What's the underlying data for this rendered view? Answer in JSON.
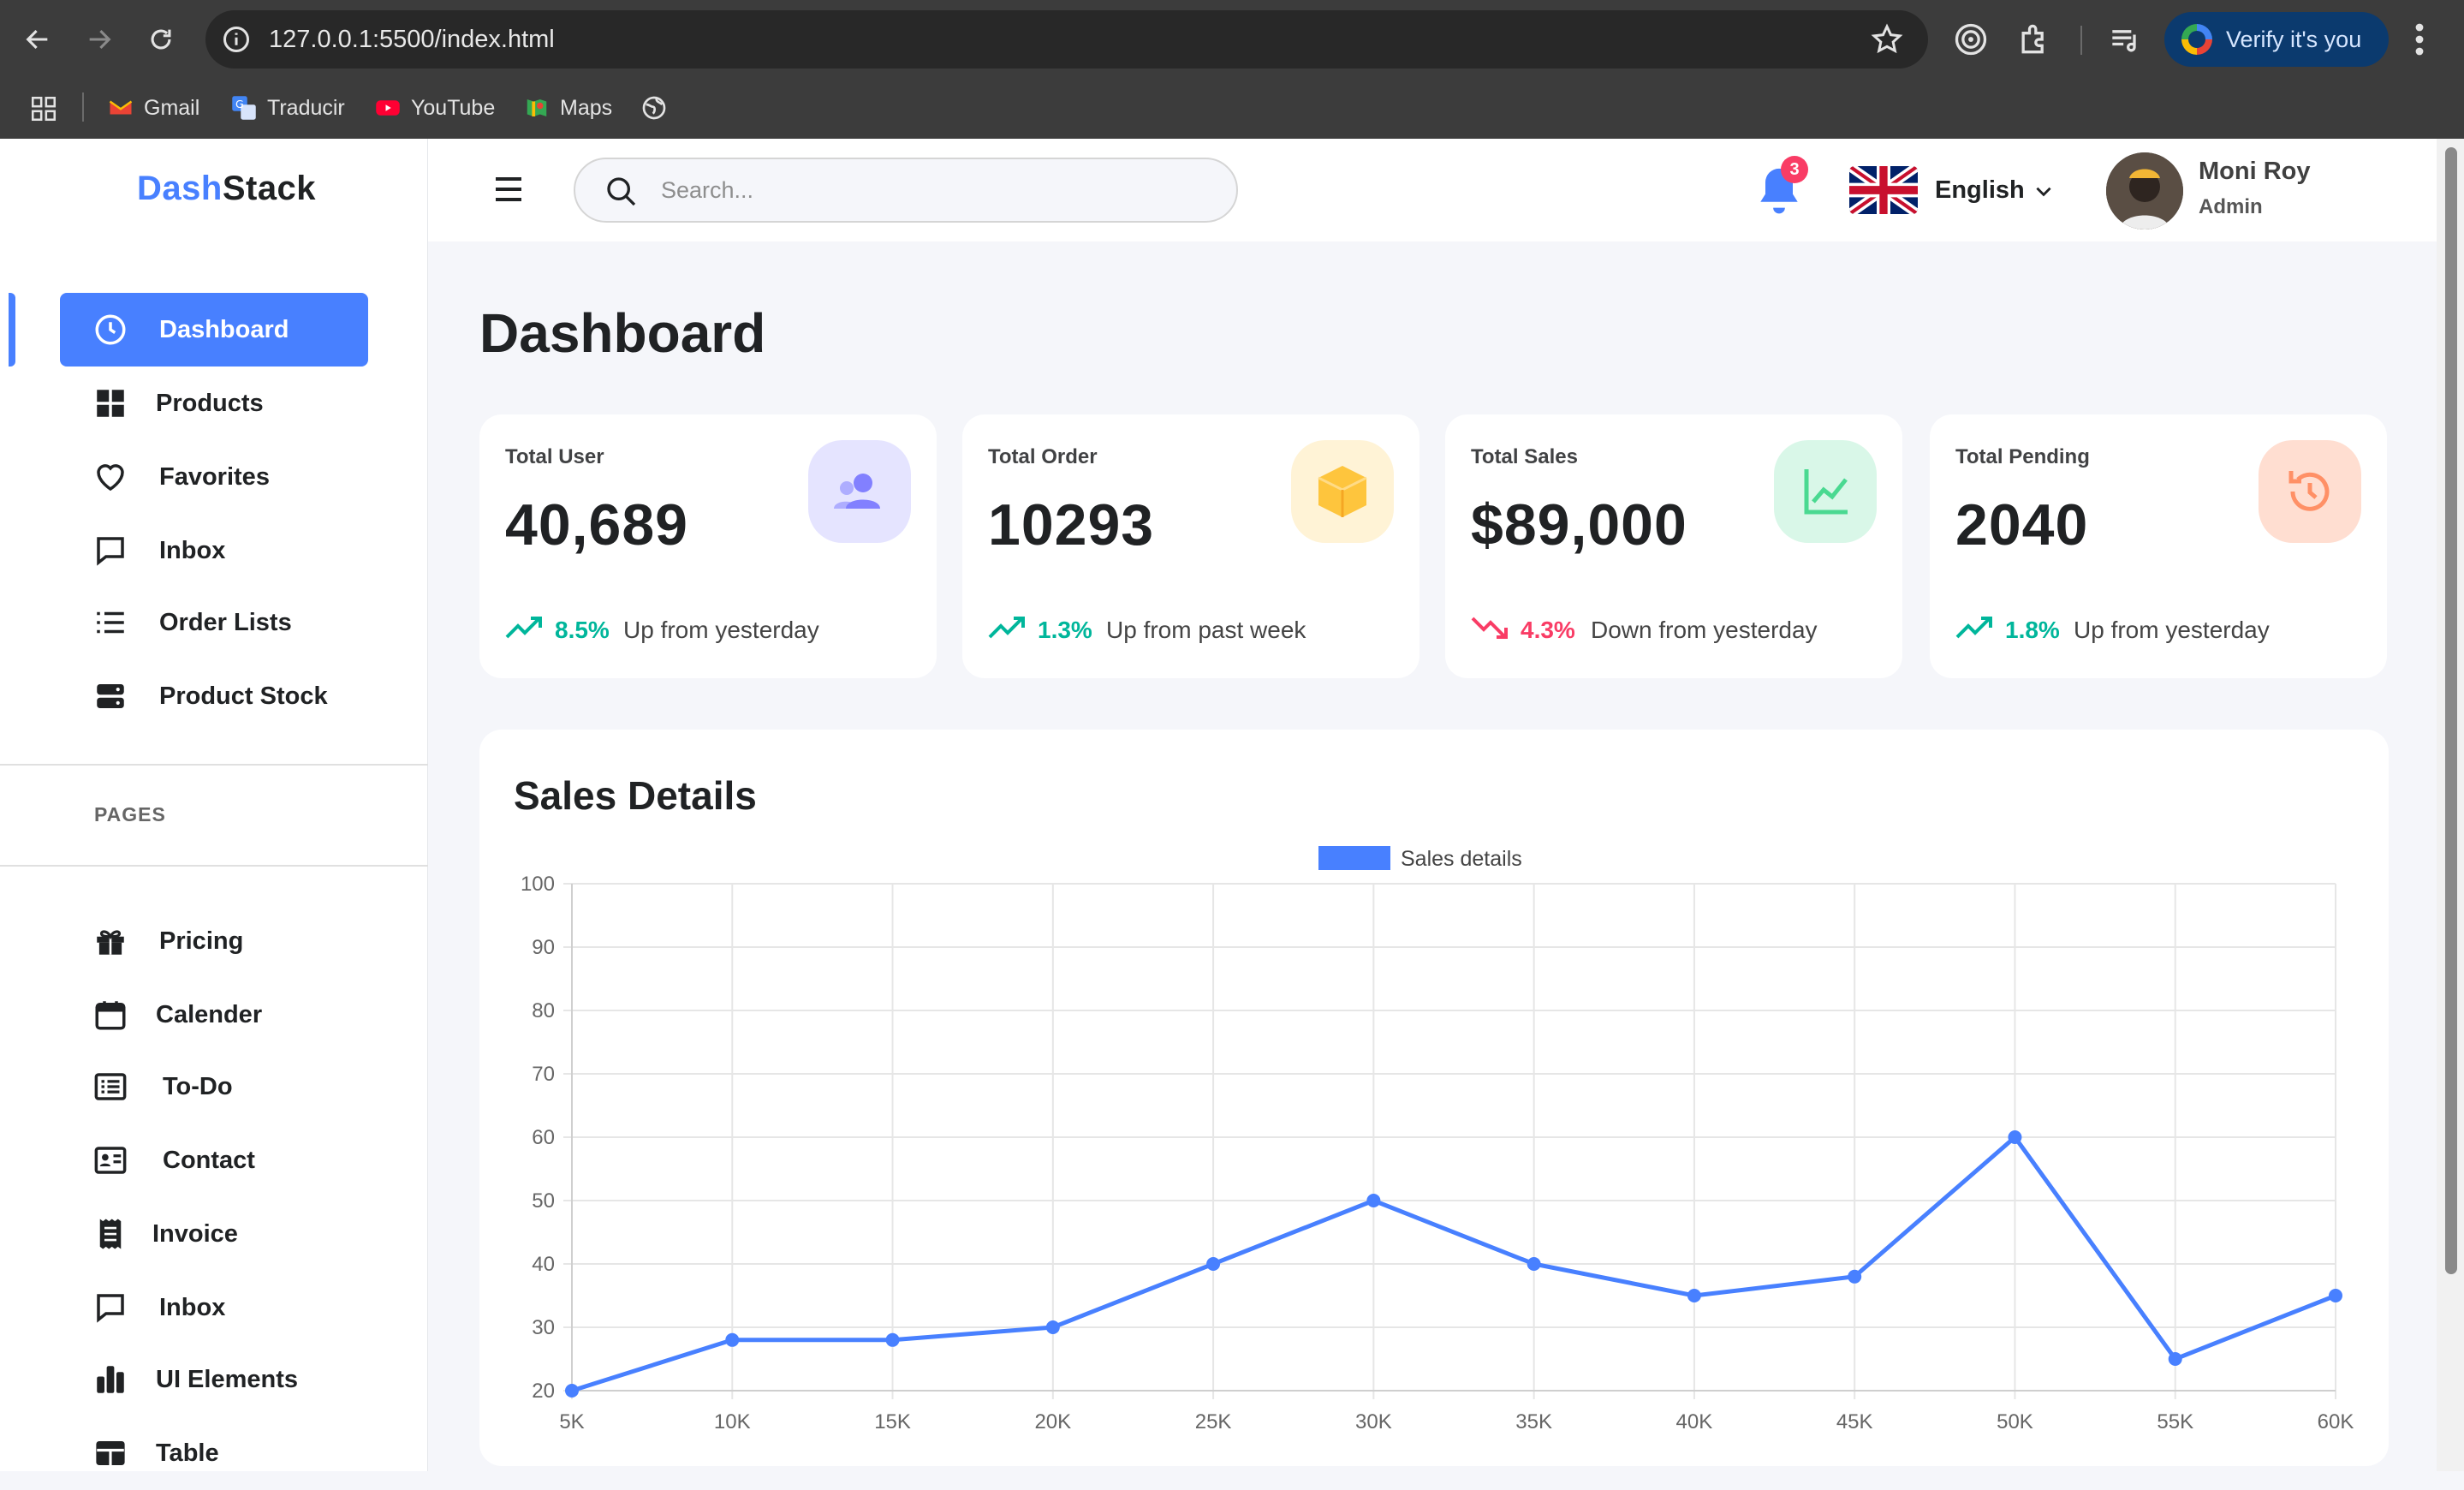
{
  "browser": {
    "url": "127.0.0.1:5500/index.html",
    "verify_label": "Verify it's you",
    "bookmarks": [
      {
        "label": "Gmail",
        "icon": "gmail-icon"
      },
      {
        "label": "Traducir",
        "icon": "translate-icon"
      },
      {
        "label": "YouTube",
        "icon": "youtube-icon"
      },
      {
        "label": "Maps",
        "icon": "maps-icon"
      }
    ]
  },
  "brand": {
    "part1": "Dash",
    "part2": "Stack",
    "accent": "#4880FF"
  },
  "header": {
    "search_placeholder": "Search...",
    "notification_count": "3",
    "language": "English",
    "user_name": "Moni Roy",
    "user_role": "Admin"
  },
  "sidebar": {
    "main_items": [
      {
        "label": "Dashboard",
        "icon": "clock-icon",
        "active": true
      },
      {
        "label": "Products",
        "icon": "grid-icon"
      },
      {
        "label": "Favorites",
        "icon": "heart-icon"
      },
      {
        "label": "Inbox",
        "icon": "message-icon"
      },
      {
        "label": "Order Lists",
        "icon": "list-icon"
      },
      {
        "label": "Product Stock",
        "icon": "stack-icon"
      }
    ],
    "pages_label": "PAGES",
    "page_items": [
      {
        "label": "Pricing",
        "icon": "gift-icon"
      },
      {
        "label": "Calender",
        "icon": "calendar-icon"
      },
      {
        "label": "To-Do",
        "icon": "todo-icon"
      },
      {
        "label": "Contact",
        "icon": "contact-card-icon"
      },
      {
        "label": "Invoice",
        "icon": "invoice-icon"
      },
      {
        "label": "Inbox",
        "icon": "message-icon"
      },
      {
        "label": "UI Elements",
        "icon": "bar-chart-icon"
      },
      {
        "label": "Table",
        "icon": "table-icon"
      }
    ]
  },
  "main": {
    "title": "Dashboard",
    "cards": [
      {
        "title": "Total User",
        "value": "40,689",
        "pct": "8.5%",
        "desc": "Up from yesterday",
        "dir": "up",
        "icon": "users-icon",
        "icon_bg": "#E5E4FF",
        "icon_color": "#8280FF"
      },
      {
        "title": "Total Order",
        "value": "10293",
        "pct": "1.3%",
        "desc": "Up from past week",
        "dir": "up",
        "icon": "box-icon",
        "icon_bg": "#FFF3D6",
        "icon_color": "#FEC53D"
      },
      {
        "title": "Total Sales",
        "value": "$89,000",
        "pct": "4.3%",
        "desc": "Down from yesterday",
        "dir": "down",
        "icon": "line-chart-icon",
        "icon_bg": "#D9F7E8",
        "icon_color": "#4AD991"
      },
      {
        "title": "Total Pending",
        "value": "2040",
        "pct": "1.8%",
        "desc": "Up from yesterday",
        "dir": "up",
        "icon": "history-icon",
        "icon_bg": "#FFDED1",
        "icon_color": "#FF9066"
      }
    ],
    "sales_title": "Sales Details"
  },
  "chart_data": {
    "type": "line",
    "title": "Sales Details",
    "x": [
      "5K",
      "10K",
      "15K",
      "20K",
      "25K",
      "30K",
      "35K",
      "40K",
      "45K",
      "50K",
      "55K",
      "60K"
    ],
    "series": [
      {
        "name": "Sales details",
        "values": [
          20,
          28,
          28,
          30,
          40,
          50,
          40,
          35,
          38,
          60,
          25,
          35
        ],
        "color": "#4880FF"
      }
    ],
    "ylim": [
      20,
      100
    ],
    "yticks": [
      20,
      30,
      40,
      50,
      60,
      70,
      80,
      90,
      100
    ],
    "grid": true,
    "legend": "top-center"
  }
}
